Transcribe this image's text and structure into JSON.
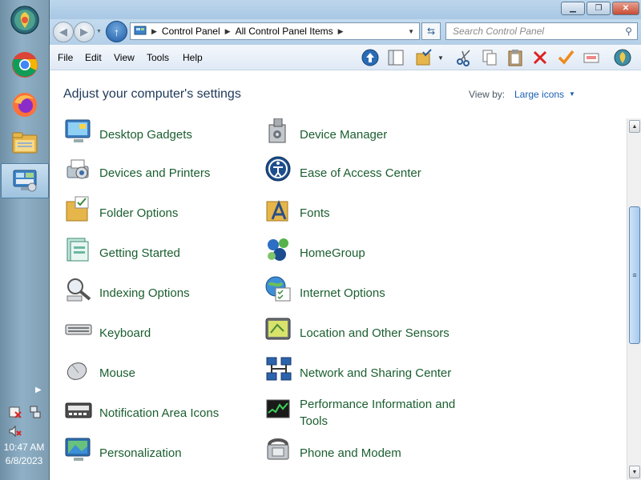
{
  "taskbar": {
    "apps": [
      {
        "name": "start-orb"
      },
      {
        "name": "chrome"
      },
      {
        "name": "firefox"
      },
      {
        "name": "file-explorer"
      },
      {
        "name": "control-panel"
      }
    ],
    "clock_time": "10:47 AM",
    "clock_date": "6/8/2023"
  },
  "window": {
    "caption": {
      "minimize": "▁",
      "restore": "❐",
      "close": "✕"
    },
    "address": {
      "crumbs": [
        "Control Panel",
        "All Control Panel Items"
      ],
      "search_placeholder": "Search Control Panel"
    },
    "menu": [
      "File",
      "Edit",
      "View",
      "Tools",
      "Help"
    ],
    "header": {
      "title": "Adjust your computer's settings",
      "view_by_label": "View by:",
      "view_by_value": "Large icons"
    },
    "items_left": [
      "Desktop Gadgets",
      "Devices and Printers",
      "Folder Options",
      "Getting Started",
      "Indexing Options",
      "Keyboard",
      "Mouse",
      "Notification Area Icons",
      "Personalization"
    ],
    "items_right": [
      "Device Manager",
      "Ease of Access Center",
      "Fonts",
      "HomeGroup",
      "Internet Options",
      "Location and Other Sensors",
      "Network and Sharing Center",
      "Performance Information and Tools",
      "Phone and Modem"
    ]
  },
  "colors": {
    "item_text": "#1a5e2f",
    "title_text": "#1e3958",
    "link_blue": "#1a5fb4"
  }
}
